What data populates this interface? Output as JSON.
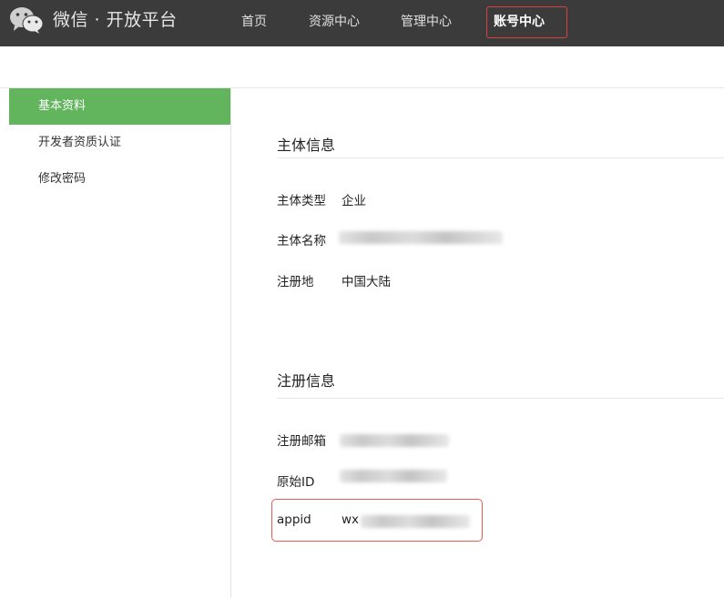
{
  "header": {
    "logo_text": "微信 · 开放平台",
    "nav": [
      {
        "label": "首页"
      },
      {
        "label": "资源中心"
      },
      {
        "label": "管理中心"
      },
      {
        "label": "账号中心"
      }
    ],
    "active_nav": "账号中心"
  },
  "sidebar": {
    "items": [
      {
        "label": "基本资料",
        "active": true
      },
      {
        "label": "开发者资质认证",
        "active": false
      },
      {
        "label": "修改密码",
        "active": false
      }
    ]
  },
  "subject_info": {
    "title": "主体信息",
    "rows": [
      {
        "label": "主体类型",
        "value": "企业"
      },
      {
        "label": "主体名称",
        "value": ""
      },
      {
        "label": "注册地",
        "value": "中国大陆"
      }
    ]
  },
  "register_info": {
    "title": "注册信息",
    "rows": [
      {
        "label": "注册邮箱",
        "value": ""
      },
      {
        "label": "原始ID",
        "value": ""
      },
      {
        "label": "appid",
        "value": "wx"
      }
    ]
  },
  "colors": {
    "topbar": "#3b3b3b",
    "sidebar_active": "#62b55d",
    "highlight_border": "#d9413f"
  }
}
